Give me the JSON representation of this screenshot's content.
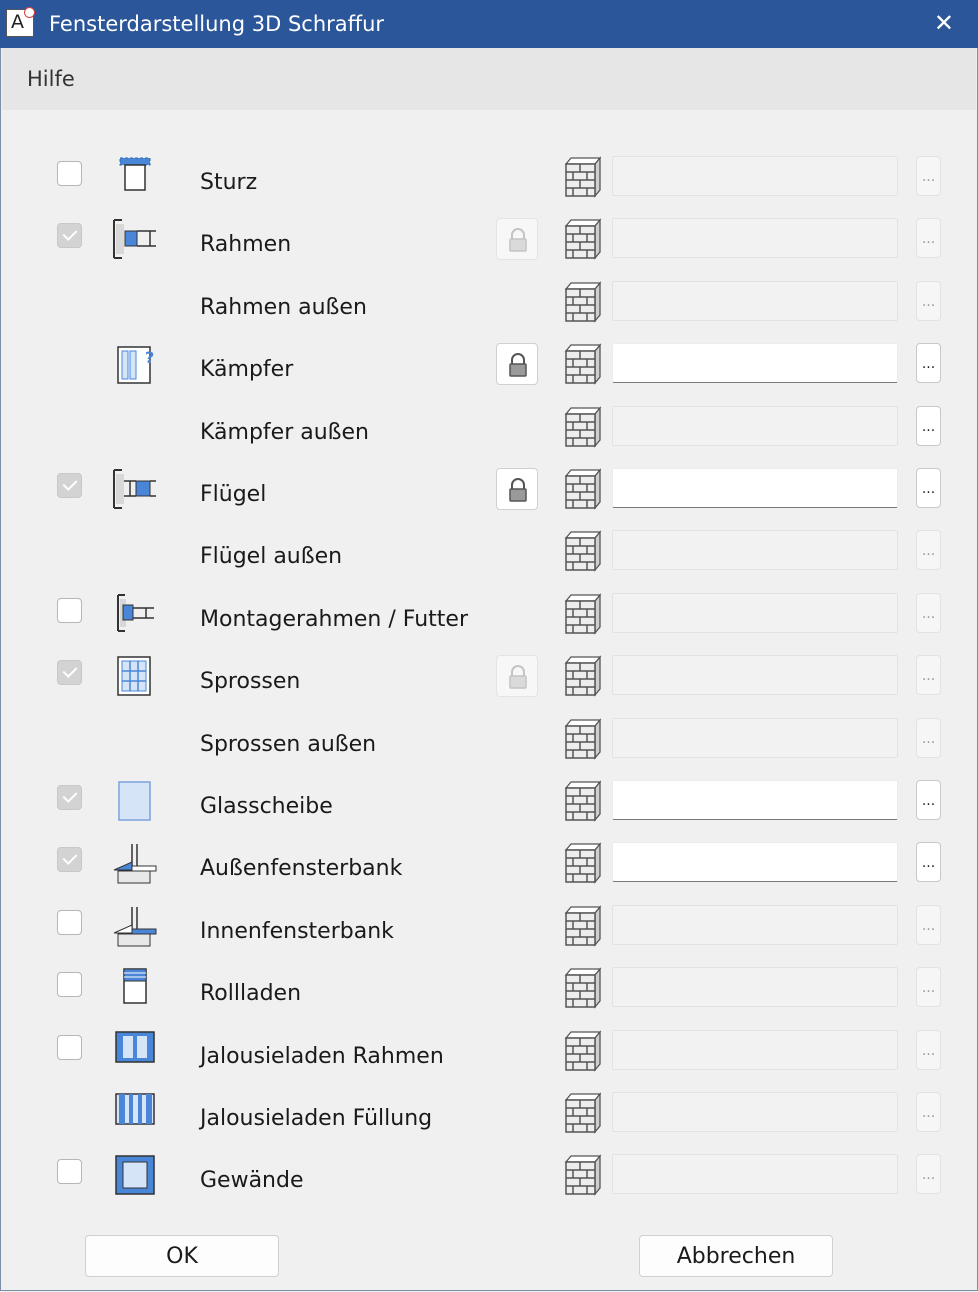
{
  "window": {
    "title": "Fensterdarstellung 3D Schraffur",
    "close_glyph": "✕",
    "app_icon_letter": "A"
  },
  "menu": {
    "items": [
      {
        "label": "Hilfe"
      }
    ]
  },
  "rows": [
    {
      "label": "Sturz",
      "checkbox": "unchecked",
      "icon": "lintel-icon",
      "lock": null,
      "field_enabled": false,
      "field_value": ""
    },
    {
      "label": "Rahmen",
      "checkbox": "checked-disabled",
      "icon": "frame-icon",
      "lock": "disabled",
      "field_enabled": false,
      "field_value": ""
    },
    {
      "label": "Rahmen außen",
      "checkbox": null,
      "icon": null,
      "lock": null,
      "field_enabled": false,
      "field_value": ""
    },
    {
      "label": "Kämpfer",
      "checkbox": null,
      "icon": "transom-icon",
      "lock": "enabled",
      "field_enabled": true,
      "field_value": ""
    },
    {
      "label": "Kämpfer außen",
      "checkbox": null,
      "icon": null,
      "lock": null,
      "field_enabled": false,
      "field_value": ""
    },
    {
      "label": "Flügel",
      "checkbox": "checked-disabled",
      "icon": "sash-icon",
      "lock": "enabled",
      "field_enabled": true,
      "field_value": ""
    },
    {
      "label": "Flügel außen",
      "checkbox": null,
      "icon": null,
      "lock": null,
      "field_enabled": false,
      "field_value": ""
    },
    {
      "label": "Montagerahmen / Futter",
      "checkbox": "unchecked",
      "icon": "mounting-frame-icon",
      "lock": null,
      "field_enabled": false,
      "field_value": ""
    },
    {
      "label": "Sprossen",
      "checkbox": "checked-disabled",
      "icon": "muntins-icon",
      "lock": "disabled",
      "field_enabled": false,
      "field_value": ""
    },
    {
      "label": "Sprossen außen",
      "checkbox": null,
      "icon": null,
      "lock": null,
      "field_enabled": false,
      "field_value": ""
    },
    {
      "label": "Glasscheibe",
      "checkbox": "checked-disabled",
      "icon": "glass-pane-icon",
      "lock": null,
      "field_enabled": true,
      "field_value": ""
    },
    {
      "label": "Außenfensterbank",
      "checkbox": "checked-disabled",
      "icon": "exterior-sill-icon",
      "lock": null,
      "field_enabled": true,
      "field_value": ""
    },
    {
      "label": "Innenfensterbank",
      "checkbox": "unchecked",
      "icon": "interior-sill-icon",
      "lock": null,
      "field_enabled": false,
      "field_value": ""
    },
    {
      "label": "Rollladen",
      "checkbox": "unchecked",
      "icon": "roller-shutter-icon",
      "lock": null,
      "field_enabled": false,
      "field_value": ""
    },
    {
      "label": "Jalousieladen Rahmen",
      "checkbox": "unchecked",
      "icon": "shutter-frame-icon",
      "lock": null,
      "field_enabled": false,
      "field_value": ""
    },
    {
      "label": "Jalousieladen Füllung",
      "checkbox": null,
      "icon": "shutter-panel-icon",
      "lock": null,
      "field_enabled": false,
      "field_value": ""
    },
    {
      "label": "Gewände",
      "checkbox": "unchecked",
      "icon": "reveal-icon",
      "lock": null,
      "field_enabled": false,
      "field_value": ""
    }
  ],
  "row_buttons": {
    "browse_label": "...",
    "hatch_icon": "brick-hatch-icon",
    "lock_icon": "lock-icon"
  },
  "footer": {
    "ok_label": "OK",
    "cancel_label": "Abbrechen"
  },
  "colors": {
    "titlebar": "#2b579a",
    "icon_blue": "#4a86d8",
    "icon_blue_light": "#d6e4f7",
    "icon_outline": "#333333"
  }
}
